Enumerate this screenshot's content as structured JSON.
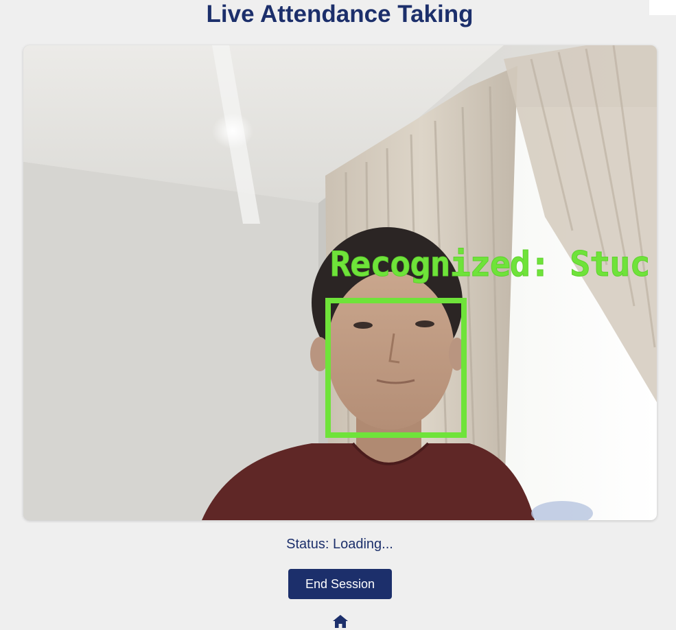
{
  "page": {
    "title": "Live Attendance Taking"
  },
  "camera": {
    "overlay_label": "Recognized: Stuc",
    "box_color": "#6fe33a"
  },
  "status": {
    "text": "Status: Loading..."
  },
  "actions": {
    "end_session_label": "End Session",
    "home_icon": "home-icon"
  },
  "colors": {
    "primary": "#1c2f6b",
    "background": "#efefef"
  }
}
